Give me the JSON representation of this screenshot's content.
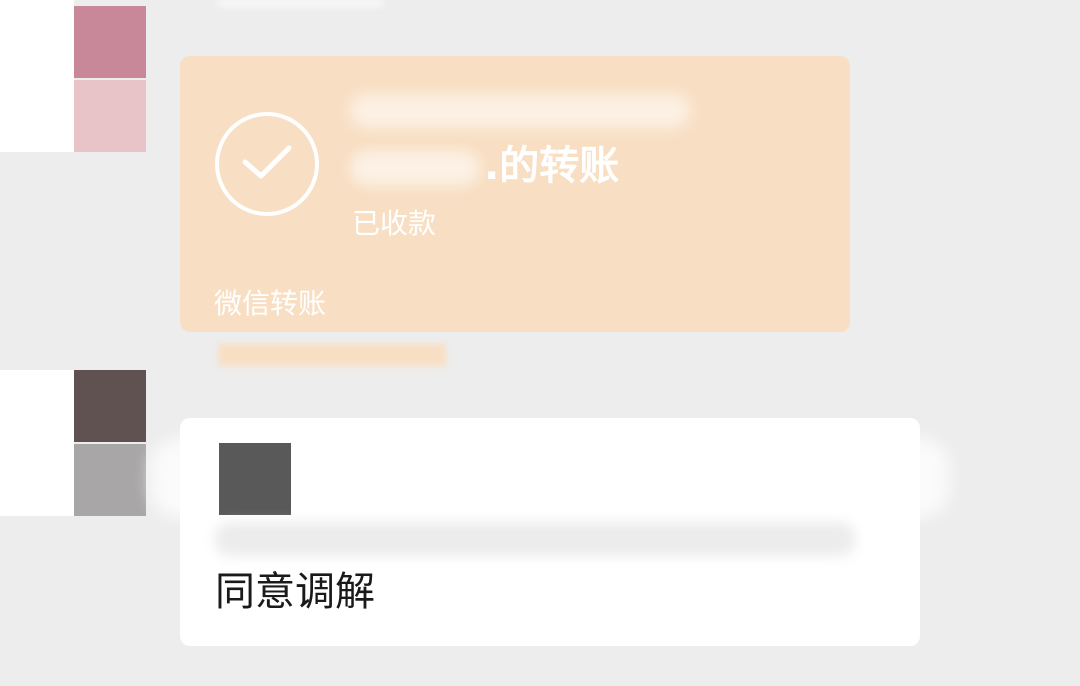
{
  "transfer_card": {
    "title_visible": ".的转账",
    "status": "已收款",
    "footer": "微信转账"
  },
  "text_card": {
    "message": "同意调解"
  },
  "colors": {
    "background": "#ededed",
    "transfer_card": "#f8dfc3",
    "text_card": "#ffffff",
    "avatar_top_a": "#c9879a",
    "avatar_top_b": "#e8c3c8",
    "avatar_bottom_a": "#5f5250",
    "avatar_bottom_b": "#a8a6a6"
  },
  "icons": {
    "transfer": "check-circle-icon"
  }
}
